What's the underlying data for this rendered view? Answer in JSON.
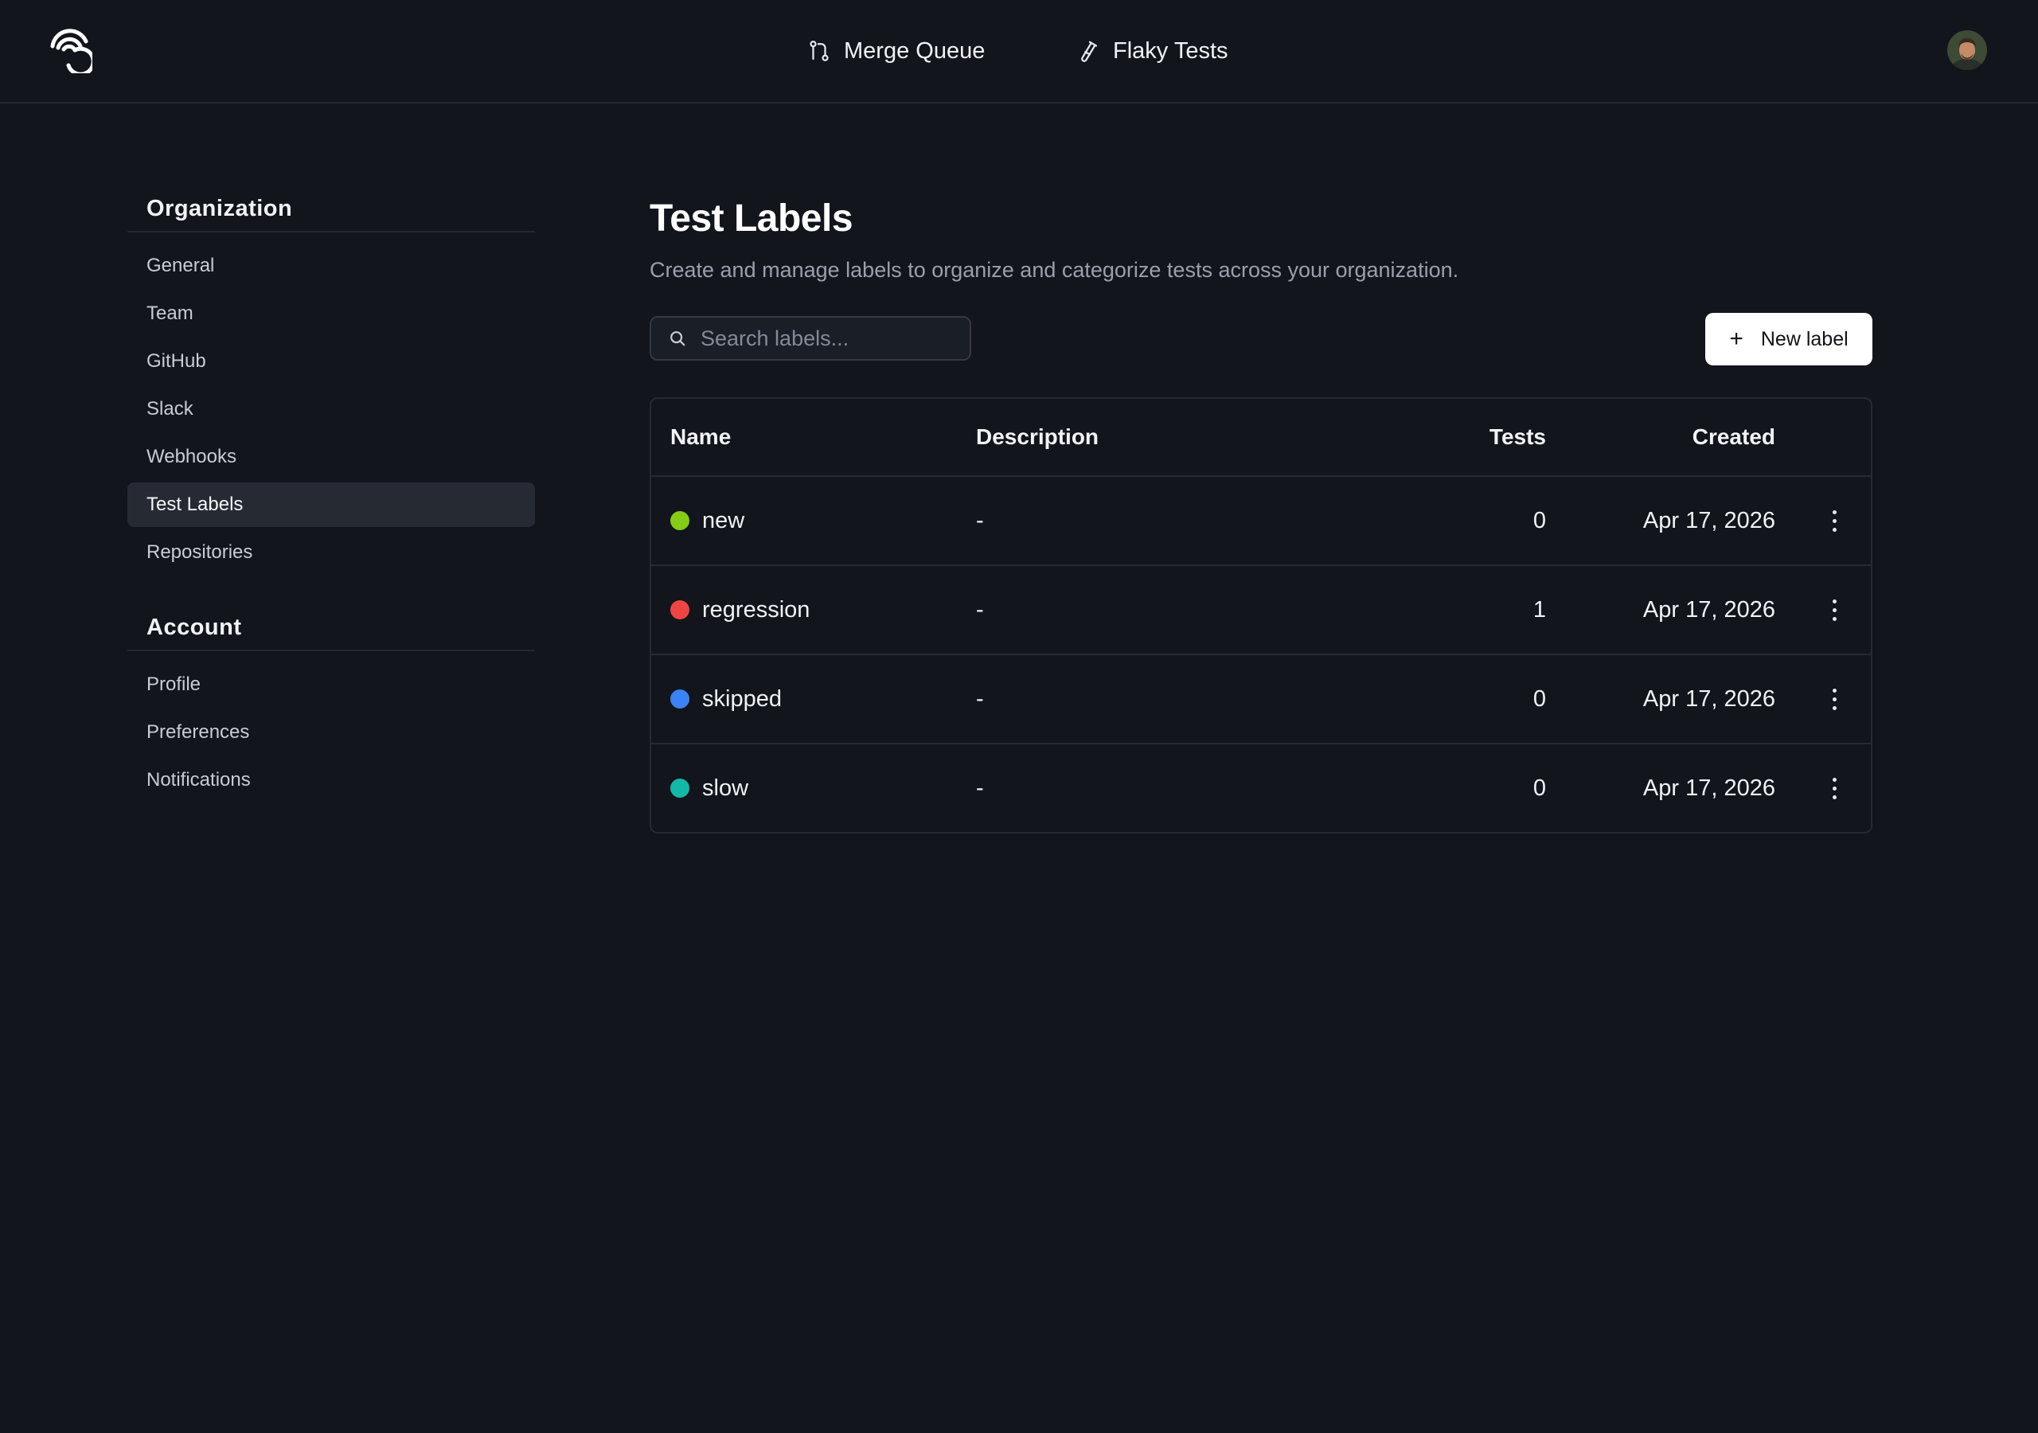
{
  "topnav": {
    "merge_queue": "Merge Queue",
    "flaky_tests": "Flaky Tests"
  },
  "sidebar": {
    "organization_title": "Organization",
    "organization_items": [
      {
        "label": "General"
      },
      {
        "label": "Team"
      },
      {
        "label": "GitHub"
      },
      {
        "label": "Slack"
      },
      {
        "label": "Webhooks"
      },
      {
        "label": "Test Labels"
      },
      {
        "label": "Repositories"
      }
    ],
    "account_title": "Account",
    "account_items": [
      {
        "label": "Profile"
      },
      {
        "label": "Preferences"
      },
      {
        "label": "Notifications"
      }
    ]
  },
  "main": {
    "title": "Test Labels",
    "description": "Create and manage labels to organize and categorize tests across your organization.",
    "search_placeholder": "Search labels...",
    "new_label_button": "New label"
  },
  "table": {
    "headers": {
      "name": "Name",
      "description": "Description",
      "tests": "Tests",
      "created": "Created"
    },
    "rows": [
      {
        "name": "new",
        "color": "#84cc16",
        "description": "-",
        "tests": "0",
        "created": "Apr 17, 2026"
      },
      {
        "name": "regression",
        "color": "#ef4444",
        "description": "-",
        "tests": "1",
        "created": "Apr 17, 2026"
      },
      {
        "name": "skipped",
        "color": "#3b82f6",
        "description": "-",
        "tests": "0",
        "created": "Apr 17, 2026"
      },
      {
        "name": "slow",
        "color": "#14b8a6",
        "description": "-",
        "tests": "0",
        "created": "Apr 17, 2026"
      }
    ]
  },
  "icons": {
    "logo": "spiral-logo-icon",
    "merge_queue": "git-merge-icon",
    "flaky_tests": "test-tube-icon",
    "search": "search-icon",
    "plus": "plus-icon",
    "row_menu": "more-vertical-icon"
  }
}
